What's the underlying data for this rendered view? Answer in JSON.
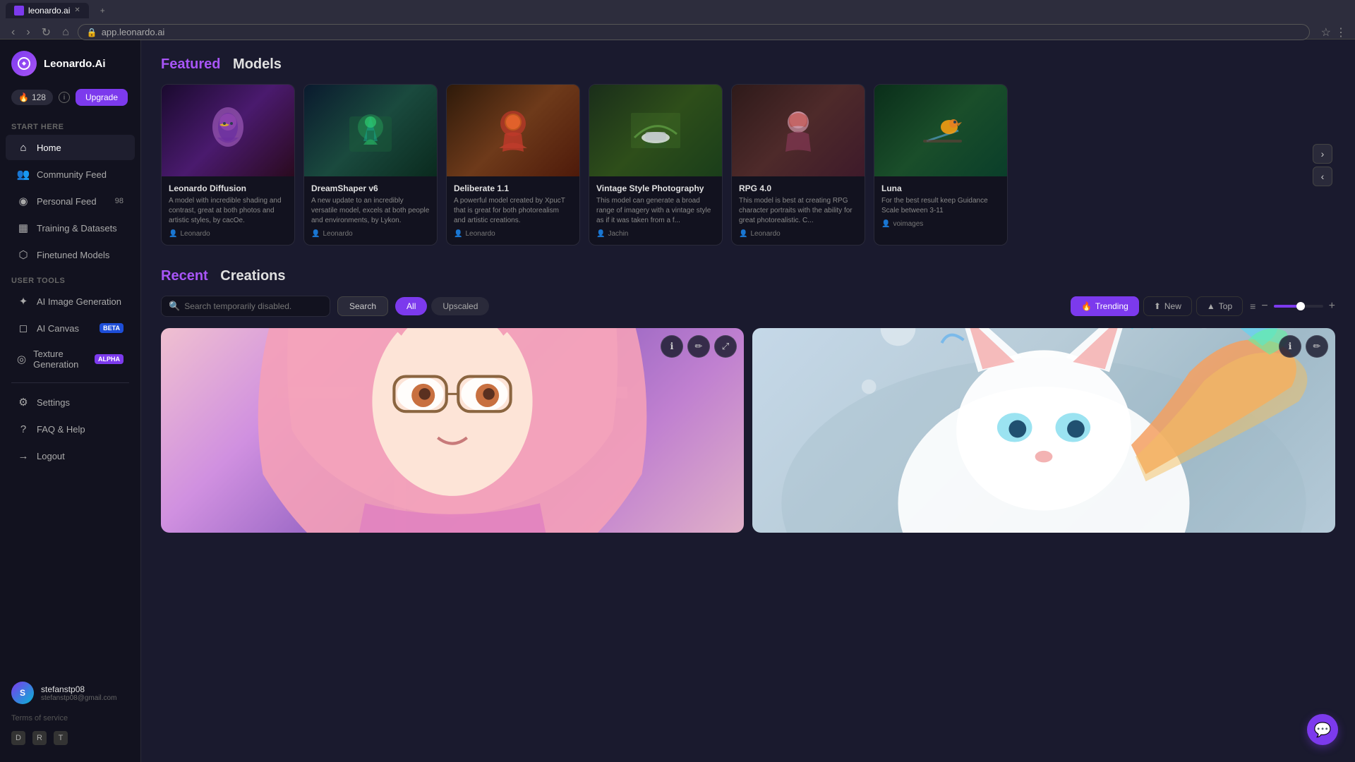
{
  "browser": {
    "tab_title": "leonardo.ai",
    "url": "app.leonardo.ai",
    "favicon": "L"
  },
  "sidebar": {
    "logo_text": "Leonardo.Ai",
    "logo_initial": "L",
    "credits": {
      "amount": "128",
      "icon": "🔥",
      "info_label": "i"
    },
    "upgrade_label": "Upgrade",
    "start_here_label": "Start Here",
    "nav_items": [
      {
        "id": "home",
        "label": "Home",
        "icon": "⌂",
        "active": true
      },
      {
        "id": "community-feed",
        "label": "Community Feed",
        "icon": "👥"
      },
      {
        "id": "personal-feed",
        "label": "Personal Feed",
        "icon": "◉",
        "count": "98"
      },
      {
        "id": "training-datasets",
        "label": "Training & Datasets",
        "icon": "▦"
      },
      {
        "id": "finetuned-models",
        "label": "Finetuned Models",
        "icon": "⬡"
      }
    ],
    "user_tools_label": "User Tools",
    "tool_items": [
      {
        "id": "ai-image-generation",
        "label": "AI Image Generation",
        "icon": "✦"
      },
      {
        "id": "ai-canvas",
        "label": "AI Canvas",
        "icon": "◻",
        "badge": "BETA",
        "badge_type": "beta"
      },
      {
        "id": "texture-generation",
        "label": "Texture Generation",
        "icon": "◎",
        "badge": "ALPHA",
        "badge_type": "alpha"
      }
    ],
    "misc_items": [
      {
        "id": "settings",
        "label": "Settings",
        "icon": "⚙"
      },
      {
        "id": "faq-help",
        "label": "FAQ & Help",
        "icon": "?"
      },
      {
        "id": "logout",
        "label": "Logout",
        "icon": "→"
      }
    ],
    "user": {
      "name": "stefanstp08",
      "email": "stefanstp08@gmail.com",
      "initial": "S"
    },
    "tos_label": "Terms of service",
    "social": [
      "discord",
      "reddit",
      "twitter"
    ]
  },
  "featured_models": {
    "section_title_highlight": "Featured",
    "section_title_normal": "Models",
    "models": [
      {
        "id": "leonardo-diffusion",
        "name": "Leonardo Diffusion",
        "description": "A model with incredible shading and contrast, great at both photos and artistic styles, by cacOe.",
        "author": "Leonardo",
        "color_class": "model-leonardo-diffusion"
      },
      {
        "id": "dreamshaper-v6",
        "name": "DreamShaper v6",
        "description": "A new update to an incredibly versatile model, excels at both people and environments, by Lykon.",
        "author": "Leonardo",
        "color_class": "model-dreamshaper"
      },
      {
        "id": "deliberate-1-1",
        "name": "Deliberate 1.1",
        "description": "A powerful model created by XpucT that is great for both photorealism and artistic creations.",
        "author": "Leonardo",
        "color_class": "model-deliberate"
      },
      {
        "id": "vintage-style-photography",
        "name": "Vintage Style Photography",
        "description": "This model can generate a broad range of imagery with a vintage style as if it was taken from a f...",
        "author": "Jachin",
        "color_class": "model-vintage"
      },
      {
        "id": "rpg-4-0",
        "name": "RPG 4.0",
        "description": "This model is best at creating RPG character portraits with the ability for great photorealistic. C...",
        "author": "Leonardo",
        "color_class": "model-rpg"
      },
      {
        "id": "luna",
        "name": "Luna",
        "description": "For the best result keep Guidance Scale between 3-11",
        "author": "voimages",
        "color_class": "model-luna"
      }
    ]
  },
  "recent_creations": {
    "section_title_highlight": "Recent",
    "section_title_normal": "Creations",
    "search_placeholder": "Search temporarily disabled.",
    "search_button": "Search",
    "tabs": [
      {
        "id": "all",
        "label": "All",
        "active": true
      },
      {
        "id": "upscaled",
        "label": "Upscaled",
        "active": false
      }
    ],
    "trend_buttons": [
      {
        "id": "trending",
        "label": "Trending",
        "icon": "🔥",
        "active": true
      },
      {
        "id": "new",
        "label": "New",
        "icon": "⬆",
        "active": false
      },
      {
        "id": "top",
        "label": "Top",
        "icon": "▲",
        "active": false
      }
    ],
    "grid_controls": {
      "list_icon": "≡",
      "minus_label": "−",
      "plus_label": "+"
    },
    "creations": [
      {
        "id": "anime-girl",
        "color_class": "creation-anime",
        "alt": "Anime girl with pink hair and glasses"
      },
      {
        "id": "fox-creature",
        "color_class": "creation-fox",
        "alt": "Colorful fox creature"
      }
    ]
  },
  "chat_fab": {
    "icon": "💬"
  }
}
